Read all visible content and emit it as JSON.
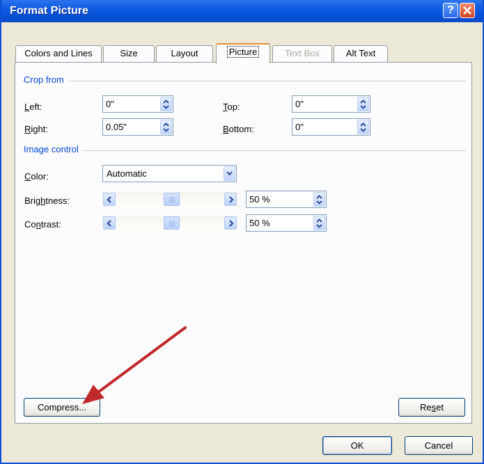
{
  "window": {
    "title": "Format Picture",
    "help_label": "?"
  },
  "tabs": [
    {
      "label": "Colors and Lines",
      "state": "normal"
    },
    {
      "label": "Size",
      "state": "normal"
    },
    {
      "label": "Layout",
      "state": "normal"
    },
    {
      "label": "Picture",
      "state": "active"
    },
    {
      "label": "Text Box",
      "state": "disabled"
    },
    {
      "label": "Alt Text",
      "state": "normal"
    }
  ],
  "crop": {
    "group_title": "Crop from",
    "left_label_key": "L",
    "left_label_rest": "eft:",
    "left_value": "0\"",
    "right_label_key": "R",
    "right_label_rest": "ight:",
    "right_value": "0.05\"",
    "top_label_key": "T",
    "top_label_rest": "op:",
    "top_value": "0\"",
    "bottom_label_key": "B",
    "bottom_label_rest": "ottom:",
    "bottom_value": "0\""
  },
  "image_control": {
    "group_title": "Image control",
    "color_label_key": "C",
    "color_label_rest": "olor:",
    "color_value": "Automatic",
    "brightness_label_pre": "Brig",
    "brightness_label_key": "h",
    "brightness_label_post": "tness:",
    "brightness_value": "50 %",
    "brightness_level": 0.5,
    "contrast_label_pre": "Co",
    "contrast_label_key": "n",
    "contrast_label_post": "trast:",
    "contrast_value": "50 %",
    "contrast_level": 0.5
  },
  "buttons": {
    "compress": "Compress...",
    "reset_pre": "Re",
    "reset_key": "s",
    "reset_post": "et",
    "ok": "OK",
    "cancel": "Cancel"
  },
  "colors": {
    "titlebar": "#0a4fd6",
    "group_title": "#0046d5",
    "annotation_arrow": "#c0282a"
  },
  "icons": [
    "help-icon",
    "close-icon",
    "spin-arrows-icon",
    "dropdown-arrow-icon",
    "scroll-left-icon",
    "scroll-right-icon"
  ]
}
